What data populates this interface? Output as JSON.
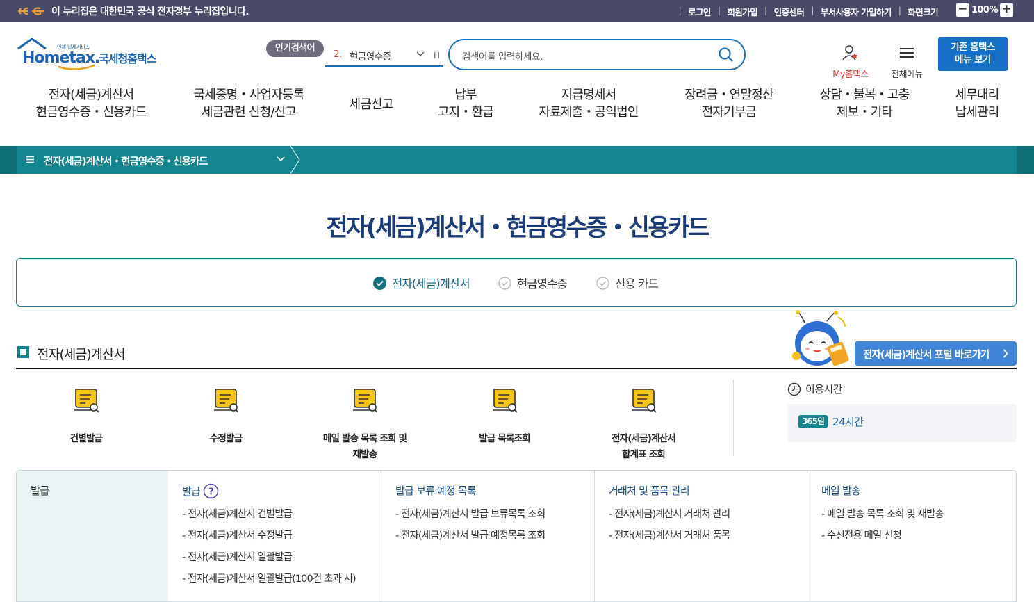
{
  "gov_bar": {
    "notice": "이 누리집은 대한민국 공식 전자정부 누리집입니다.",
    "links": [
      "로그인",
      "회원가입",
      "인증센터",
      "부서사용자 가입하기",
      "화면크기"
    ],
    "zoom": {
      "minus": "−",
      "value": "100%",
      "plus": "+"
    }
  },
  "header": {
    "logo": {
      "tagline": "언제 납세서비스",
      "brand": "Hometax.",
      "name": "국세청홈택스"
    },
    "popular_badge": "인기검색어",
    "popular_rank": "2.",
    "popular_term": "현금영수증",
    "pause": "II",
    "search_placeholder": "검색어를 입력하세요.",
    "my_hometax": "My홈택스",
    "all_menu": "전체메뉴",
    "old_menu_line1": "기존 홈택스",
    "old_menu_line2": "메뉴 보기"
  },
  "gnb": [
    {
      "l1": "전자(세금)계산서",
      "l2": "현금영수증・신용카드"
    },
    {
      "l1": "국세증명・사업자등록",
      "l2": "세금관련 신청/신고"
    },
    {
      "l1": "세금신고",
      "l2": ""
    },
    {
      "l1": "납부",
      "l2": "고지・환급"
    },
    {
      "l1": "지급명세서",
      "l2": "자료제출・공익법인"
    },
    {
      "l1": "장려금・연말정산",
      "l2": "전자기부금"
    },
    {
      "l1": "상담・불복・고충",
      "l2": "제보・기타"
    },
    {
      "l1": "세무대리",
      "l2": "납세관리"
    }
  ],
  "breadcrumb": {
    "current": "전자(세금)계산서・현금영수증・신용카드"
  },
  "page_title": "전자(세금)계산서・현금영수증・신용카드",
  "tabs": [
    {
      "label": "전자(세금)계산서",
      "active": true
    },
    {
      "label": "현금영수증",
      "active": false
    },
    {
      "label": "신용 카드",
      "active": false
    }
  ],
  "portal_button": "전자(세금)계산서 포털 바로가기",
  "section_title": "전자(세금)계산서",
  "quick_menu": [
    {
      "l1": "건별발급",
      "l2": ""
    },
    {
      "l1": "수정발급",
      "l2": ""
    },
    {
      "l1": "메일 발송 목록 조회 및",
      "l2": "재발송"
    },
    {
      "l1": "발급 목록조회",
      "l2": ""
    },
    {
      "l1": "전자(세금)계산서",
      "l2": "합계표 조회"
    }
  ],
  "use_time": {
    "label": "이용시간",
    "badge": "365일",
    "value": "24시간"
  },
  "menu_table": {
    "side_title": "발급",
    "columns": [
      {
        "title": "발급",
        "items": [
          "- 전자(세금)계산서 건별발급",
          "- 전자(세금)계산서 수정발급",
          "- 전자(세금)계산서 일괄발급",
          "- 전자(세금)계산서 일괄발급(100건 초과 시)"
        ]
      },
      {
        "title": "발급 보류 예정 목록",
        "items": [
          "- 전자(세금)계산서 발급 보류목록 조회",
          "- 전자(세금)계산서 발급 예정목록 조회"
        ]
      },
      {
        "title": "거래처 및 품목 관리",
        "items": [
          "- 전자(세금)계산서 거래처 관리",
          "- 전자(세금)계산서 거래처 품목"
        ]
      },
      {
        "title": "메일 발송",
        "items": [
          "- 메일 발송 목록 조회 및 재발송",
          "- 수신전용 메일 신청"
        ]
      }
    ]
  },
  "colors": {
    "teal": "#128591",
    "navy": "#1b3a7a",
    "blue": "#1671c6",
    "govbar": "#4a4a68"
  }
}
